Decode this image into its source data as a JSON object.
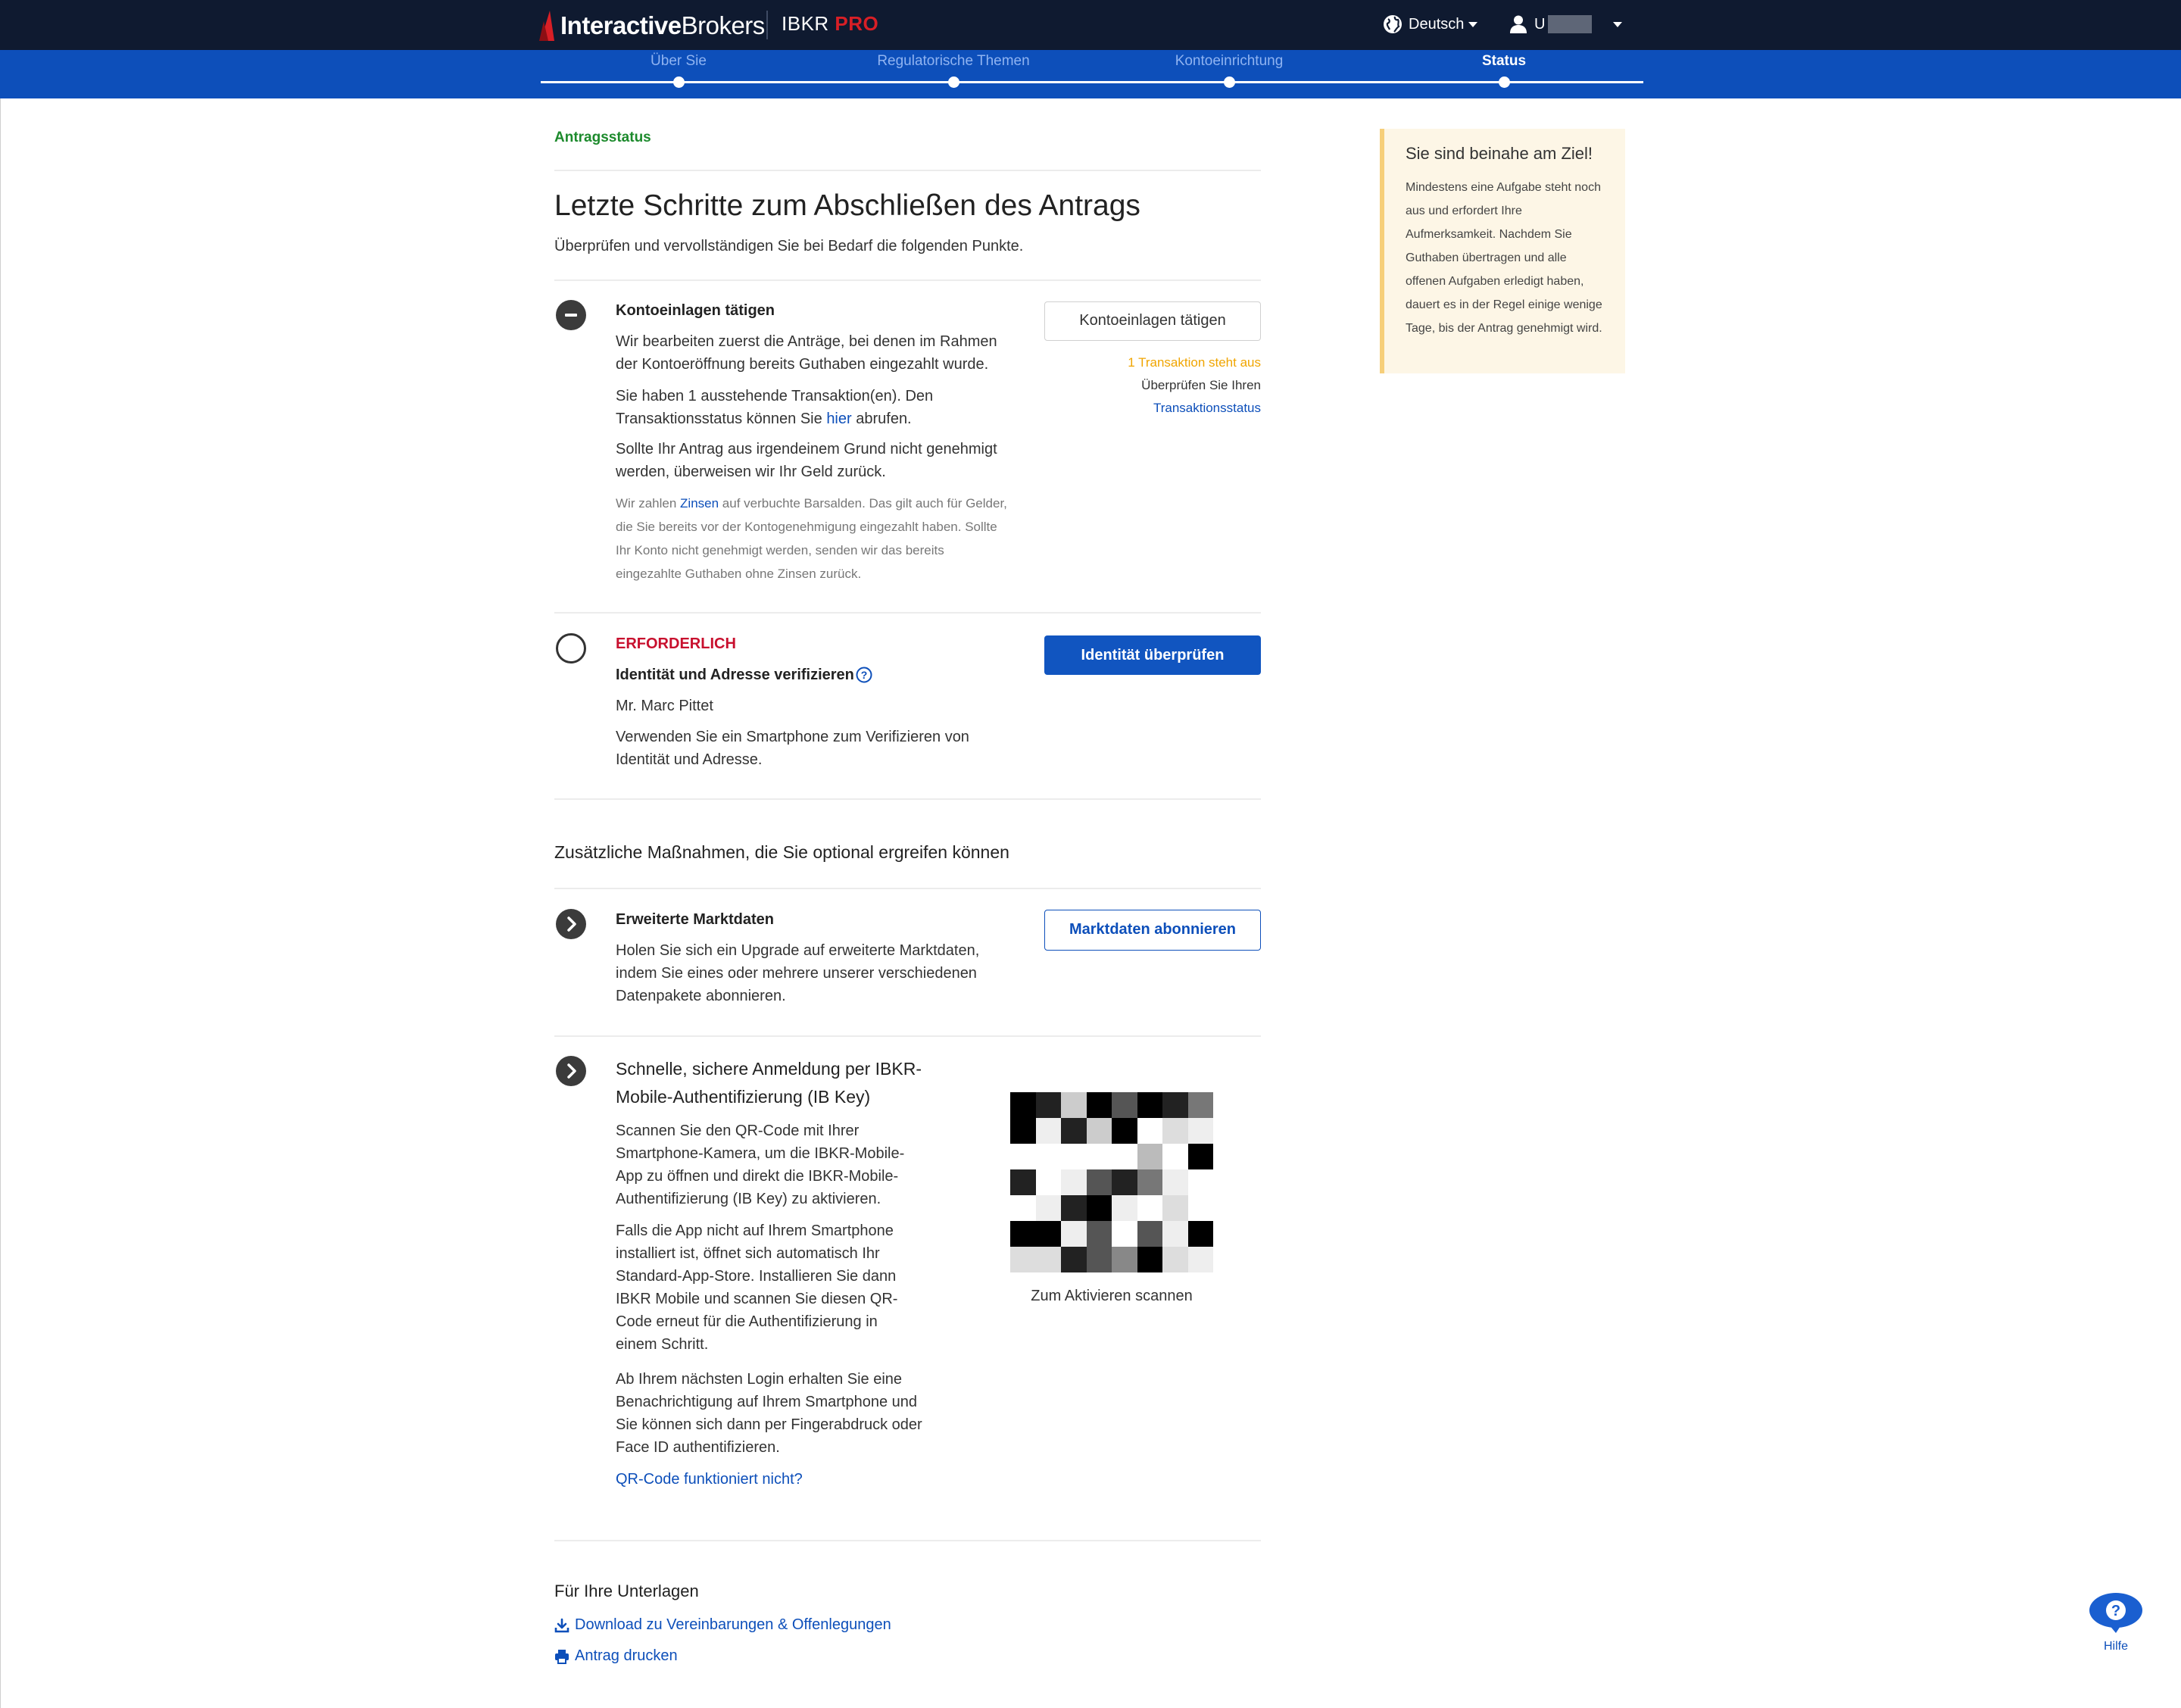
{
  "header": {
    "brand_bold": "Interactive",
    "brand_light": "Brokers",
    "product": "IBKR",
    "product_accent": "PRO",
    "language": "Deutsch",
    "user_prefix": "U"
  },
  "steps": [
    {
      "label": "Über Sie",
      "active": false
    },
    {
      "label": "Regulatorische Themen",
      "active": false
    },
    {
      "label": "Kontoeinrichtung",
      "active": false
    },
    {
      "label": "Status",
      "active": true
    }
  ],
  "breadcrumb": "Antragsstatus",
  "title": "Letzte Schritte zum Abschließen des Antrags",
  "lead": "Überprüfen und vervollständigen Sie bei Bedarf die folgenden Punkte.",
  "tasks": {
    "deposit": {
      "title": "Kontoeinlagen tätigen",
      "p1": "Wir bearbeiten zuerst die Anträge, bei denen im Rahmen der Kontoeröffnung bereits Guthaben eingezahlt wurde.",
      "p2_before": "Sie haben 1 ausstehende Transaktion(en). Den Transaktionsstatus können Sie ",
      "p2_link": "hier",
      "p2_after": " abrufen.",
      "p3": "Sollte Ihr Antrag aus irgendeinem Grund nicht genehmigt werden, überweisen wir Ihr Geld zurück.",
      "note_before": "Wir zahlen ",
      "note_link": "Zinsen",
      "note_after": " auf verbuchte Barsalden. Das gilt auch für Gelder, die Sie bereits vor der Kontogenehmigung eingezahlt haben. Sollte Ihr Konto nicht genehmigt werden, senden wir das bereits eingezahlte Guthaben ohne Zinsen zurück.",
      "button": "Kontoeinlagen tätigen",
      "status_pending": "1 Transaktion steht aus",
      "status_check": "Überprüfen Sie Ihren",
      "status_link": "Transaktionsstatus"
    },
    "identity": {
      "required": "ERFORDERLICH",
      "title": "Identität und Adresse verifizieren",
      "name": "Mr. Marc Pittet",
      "desc": "Verwenden Sie ein Smartphone zum Verifizieren von Identität und Adresse.",
      "button": "Identität überprüfen"
    }
  },
  "optional": {
    "heading": "Zusätzliche Maßnahmen, die Sie optional ergreifen können",
    "market": {
      "title": "Erweiterte Marktdaten",
      "desc": "Holen Sie sich ein Upgrade auf erweiterte Marktdaten, indem Sie eines oder mehrere unserer verschiedenen Datenpakete abonnieren.",
      "button": "Marktdaten abonnieren"
    },
    "ibkey": {
      "title": "Schnelle, sichere Anmeldung per IBKR-Mobile-Authentifizierung (IB Key)",
      "p1": "Scannen Sie den QR-Code mit Ihrer Smartphone-Kamera, um die IBKR-Mobile-App zu öffnen und direkt die IBKR-Mobile-Authentifizierung (IB Key) zu aktivieren.",
      "p2": "Falls die App nicht auf Ihrem Smartphone installiert ist, öffnet sich automatisch Ihr Standard-App-Store. Installieren Sie dann IBKR Mobile und scannen Sie diesen QR-Code erneut für die Authentifizierung in einem Schritt.",
      "p3": "Ab Ihrem nächsten Login erhalten Sie eine Benachrichtigung auf Ihrem Smartphone und Sie können sich dann per Fingerabdruck oder Face ID authentifizieren.",
      "link": "QR-Code funktioniert nicht?",
      "qr_caption": "Zum Aktivieren scannen"
    }
  },
  "records": {
    "heading": "Für Ihre Unterlagen",
    "download": "Download zu Vereinbarungen & Offenlegungen",
    "print": "Antrag drucken"
  },
  "notice": {
    "title": "Sie sind beinahe am Ziel!",
    "body": "Mindestens eine Aufgabe steht noch aus und erfordert Ihre Aufmerksamkeit. Nachdem Sie Guthaben übertragen und alle offenen Aufgaben erledigt haben, dauert es in der Regel einige wenige Tage, bis der Antrag genehmigt wird."
  },
  "help": {
    "label": "Hilfe"
  },
  "colors": {
    "topbar": "#0f1a30",
    "stepbar": "#0d4fba",
    "brand_red": "#d81f26",
    "required_red": "#c8102e",
    "success_green": "#1c8a2c",
    "pending_orange": "#f0a500",
    "notice_bg": "#fdf6e6"
  },
  "icons": [
    "globe-icon",
    "user-icon",
    "minus-icon",
    "chevron-right-icon",
    "question-circle-icon",
    "download-icon",
    "print-icon",
    "help-bubble-icon"
  ]
}
